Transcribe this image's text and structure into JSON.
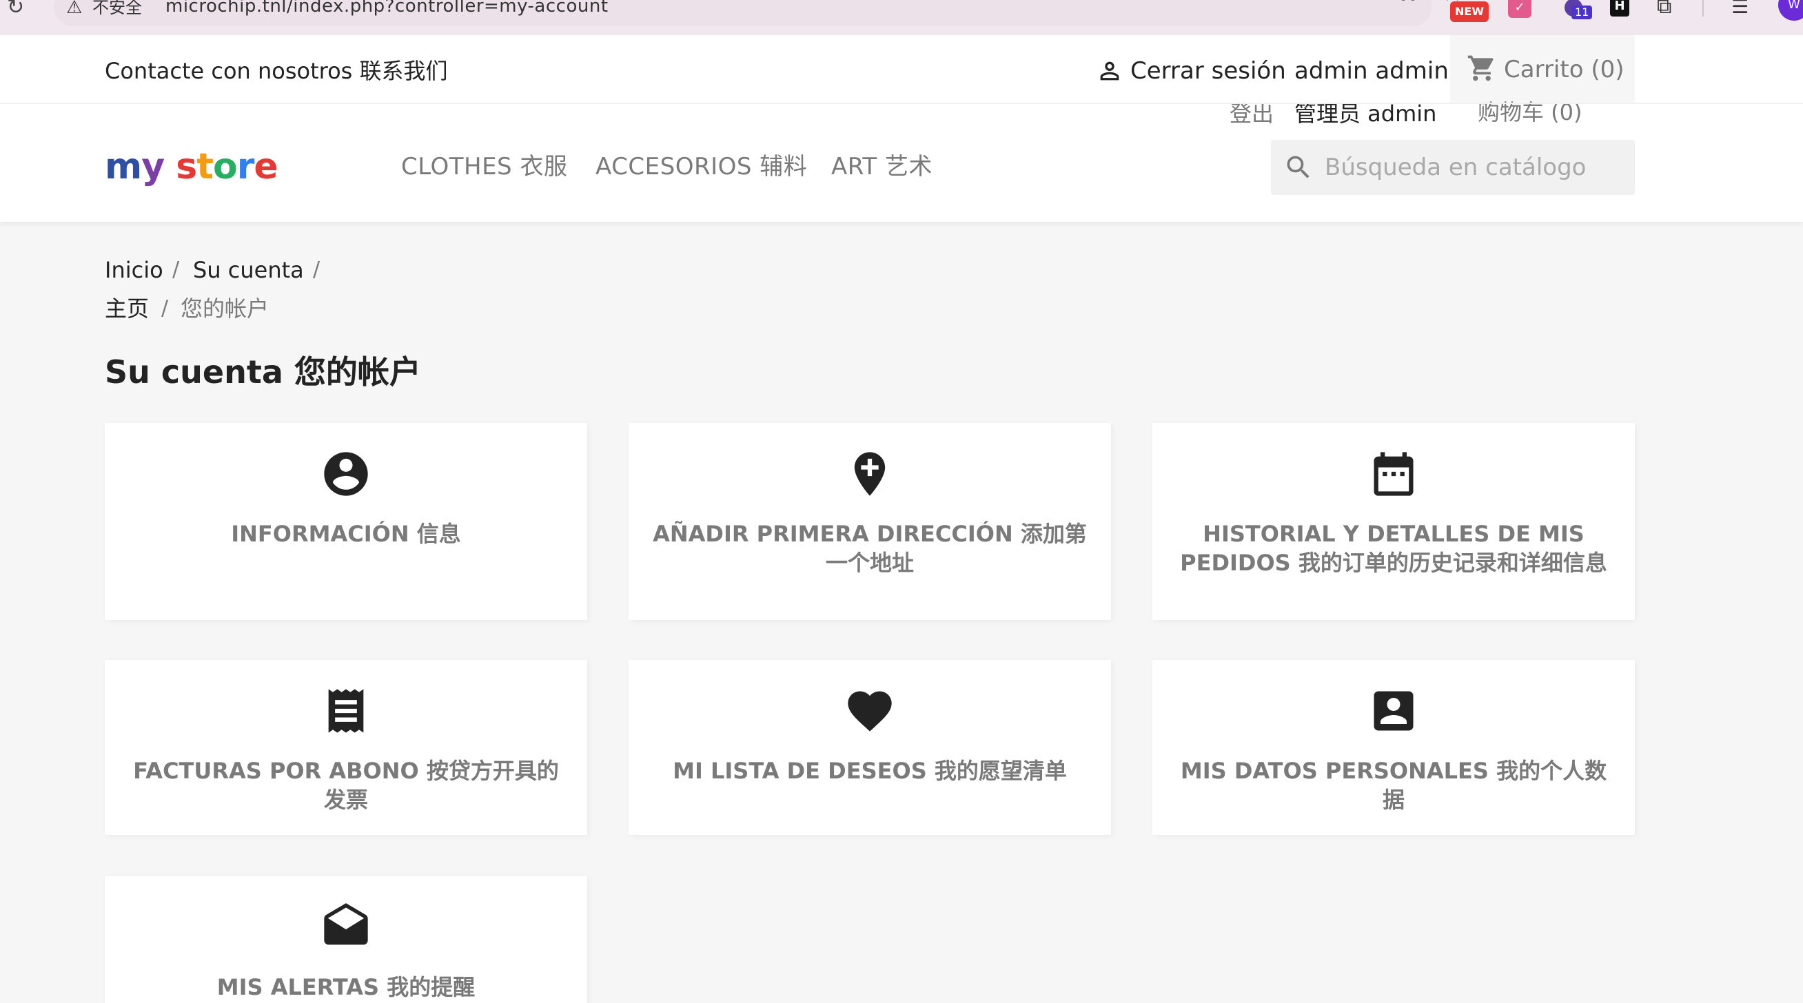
{
  "browser": {
    "not_secure_label": "不安全",
    "url": "microchip.tnl/index.php?controller=my-account",
    "new_badge": "NEW",
    "ext_count": "11",
    "ext_h_label": "H",
    "profile_initial": "W"
  },
  "header": {
    "contact": "Contacte con nosotros  联系我们",
    "logout": "Cerrar sesión",
    "account_name": "admin admin",
    "logout_cn": "登出",
    "account_name_cn": "管理员 admin",
    "cart": "Carrito (0)",
    "cart_cn": "购物车  (0)",
    "logo": {
      "part1": "m",
      "part2": "y",
      "part3": "s",
      "part4": "t",
      "part5": "o",
      "part6": "r",
      "part7": "e"
    },
    "menu": {
      "clothes": "CLOTHES  衣服",
      "accessories": "ACCESORIOS  辅料",
      "art": "ART  艺术"
    },
    "search_placeholder": "Búsqueda en catálogo"
  },
  "breadcrumb": {
    "home": "Inicio",
    "account": "Su cuenta",
    "home_cn": "主页",
    "account_cn": "您的帐户",
    "separator": "/"
  },
  "page_title": "Su cuenta  您的帐户",
  "cards": [
    {
      "label": "INFORMACIÓN  信息",
      "icon": "account-circle-icon"
    },
    {
      "label": "AÑADIR PRIMERA DIRECCIÓN  添加第一个地址",
      "icon": "add-location-icon"
    },
    {
      "label": "HISTORIAL Y DETALLES DE MIS PEDIDOS 我的订单的历史记录和详细信息",
      "icon": "calendar-icon"
    },
    {
      "label": "FACTURAS POR ABONO  按贷方开具的发票",
      "icon": "receipt-icon"
    },
    {
      "label": "MI LISTA DE DESEOS  我的愿望清单",
      "icon": "heart-icon"
    },
    {
      "label": "MIS DATOS PERSONALES  我的个人数据",
      "icon": "account-box-icon"
    },
    {
      "label": "MIS ALERTAS  我的提醒",
      "icon": "mail-open-icon"
    }
  ],
  "colors": {
    "background": "#f6f6f6",
    "card": "#ffffff",
    "text": "#232323",
    "muted": "#7a7a7a"
  }
}
